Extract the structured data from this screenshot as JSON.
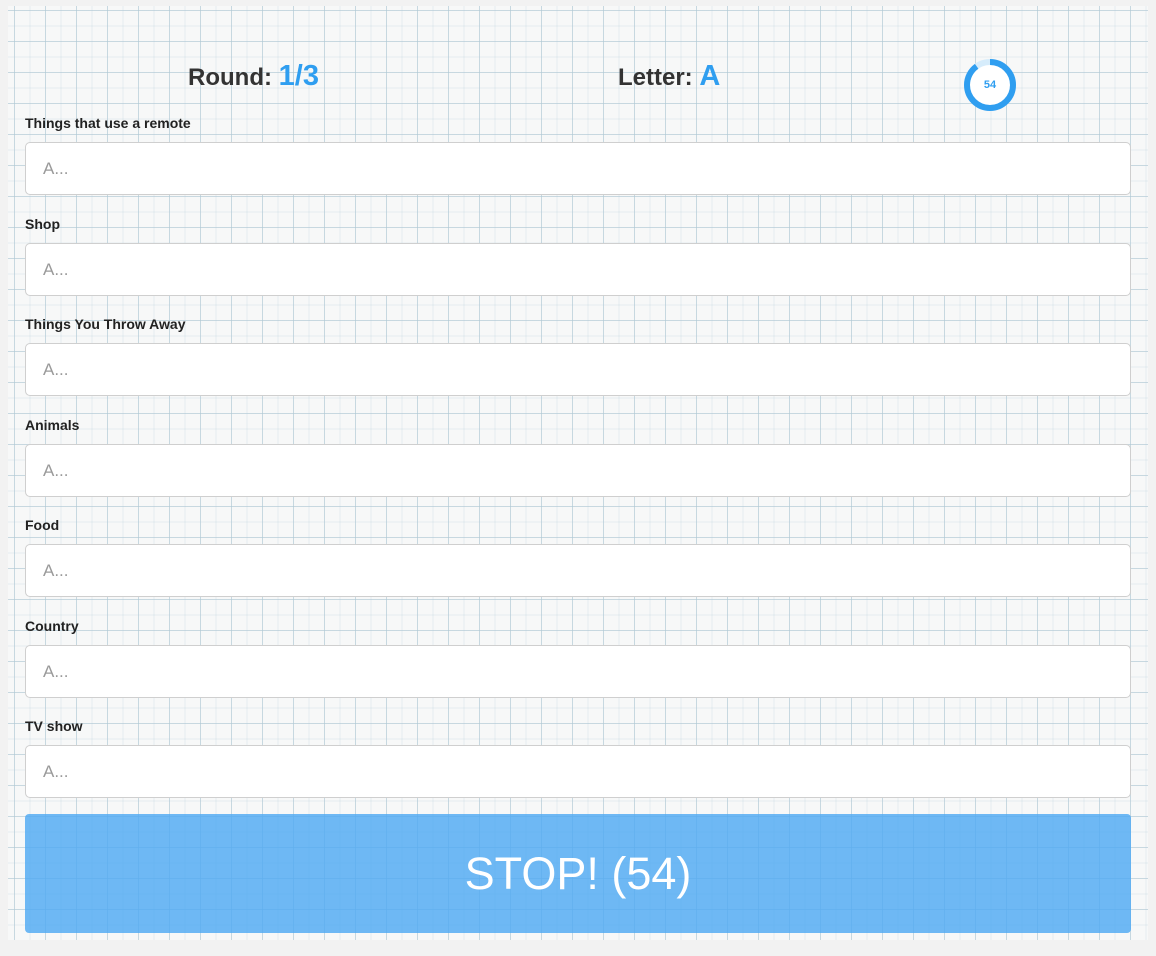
{
  "header": {
    "round_label": "Round:",
    "round_value": "1/3",
    "letter_label": "Letter:",
    "letter_value": "A",
    "timer_value": "54",
    "timer_remaining_fraction": 0.9
  },
  "colors": {
    "accent": "#2f9ef0",
    "button": "#5aaef4",
    "timer_track": "#d6ecfb"
  },
  "fields": [
    {
      "label": "Things that use a remote",
      "placeholder": "A..."
    },
    {
      "label": "Shop",
      "placeholder": "A..."
    },
    {
      "label": "Things You Throw Away",
      "placeholder": "A..."
    },
    {
      "label": "Animals",
      "placeholder": "A..."
    },
    {
      "label": "Food",
      "placeholder": "A..."
    },
    {
      "label": "Country",
      "placeholder": "A..."
    },
    {
      "label": "TV show",
      "placeholder": "A..."
    }
  ],
  "stop_button": {
    "label": "STOP! (54)"
  }
}
